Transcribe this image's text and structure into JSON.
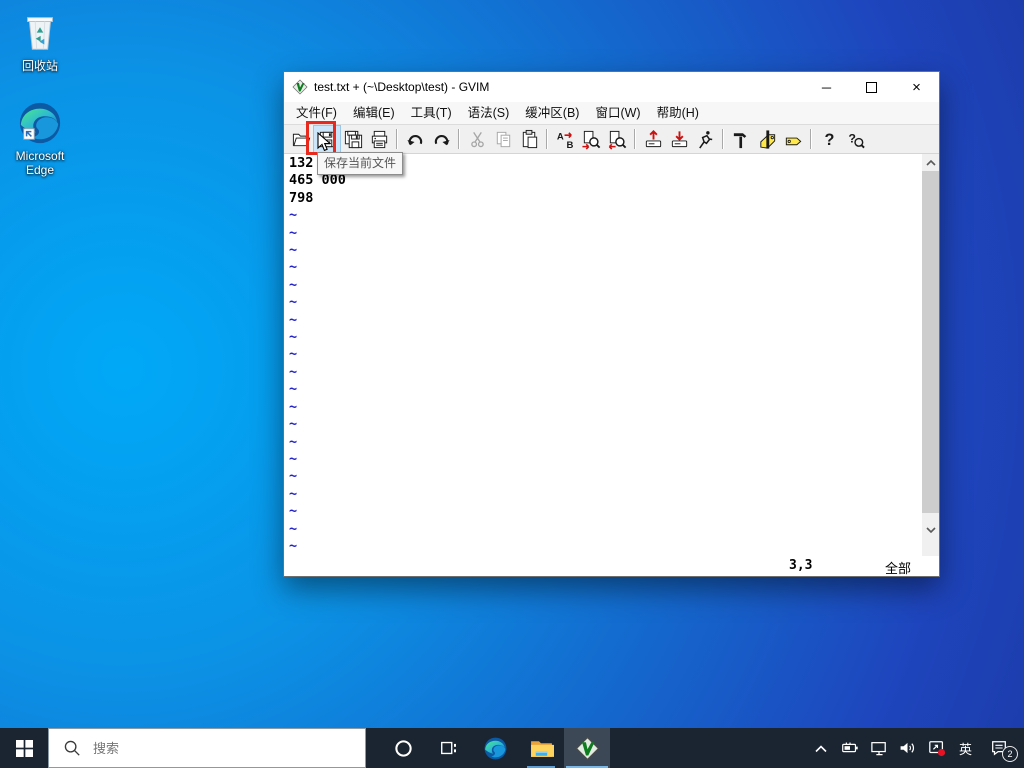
{
  "desktop": {
    "icons": [
      {
        "label": "回收站"
      },
      {
        "label": "Microsoft Edge"
      }
    ]
  },
  "gvim": {
    "title": "test.txt + (~\\Desktop\\test) - GVIM",
    "window_controls": {
      "minimize": "─",
      "maximize": "",
      "close": "×"
    },
    "menus": [
      "文件(F)",
      "编辑(E)",
      "工具(T)",
      "语法(S)",
      "缓冲区(B)",
      "窗口(W)",
      "帮助(H)"
    ],
    "toolbar": {
      "items": [
        "open",
        "save",
        "save-all",
        "print",
        "separator",
        "undo",
        "redo",
        "separator",
        "cut",
        "copy",
        "paste",
        "separator",
        "find-replace",
        "find-next",
        "find-prev",
        "separator",
        "load-session",
        "save-session",
        "run-script",
        "separator",
        "make",
        "build-tags",
        "jump-to-tag",
        "separator",
        "help",
        "find-help"
      ],
      "disabled": [
        "cut",
        "copy"
      ],
      "highlighted": "save",
      "tooltip": "保存当前文件"
    },
    "editor": {
      "lines": [
        "132",
        "465 000",
        "798"
      ],
      "tilde": "~",
      "tilde_count": 20
    },
    "status": {
      "ruler": "3,3",
      "position": "全部"
    }
  },
  "taskbar": {
    "search_placeholder": "搜索",
    "apps": [
      "cortana",
      "task-view",
      "edge",
      "file-explorer",
      "gvim"
    ],
    "running_apps": [
      "file-explorer",
      "gvim"
    ],
    "active_app": "gvim",
    "tray_icons": [
      "chevron-up",
      "battery",
      "network",
      "volume",
      "screen-app",
      "language",
      "notifications"
    ],
    "language_indicator": "英",
    "notification_count": "2"
  },
  "colors": {
    "annotation_red": "#e8291e",
    "tilde_blue": "#2222cc",
    "taskbar_bg": "#1b2431",
    "active_underline": "#7ab8e8",
    "desktop_center_blue": "#00a9f7",
    "desktop_edge_blue": "#1e45bd",
    "tag_yellow": "#ffe84a",
    "tray_dot_red": "#e81224"
  }
}
